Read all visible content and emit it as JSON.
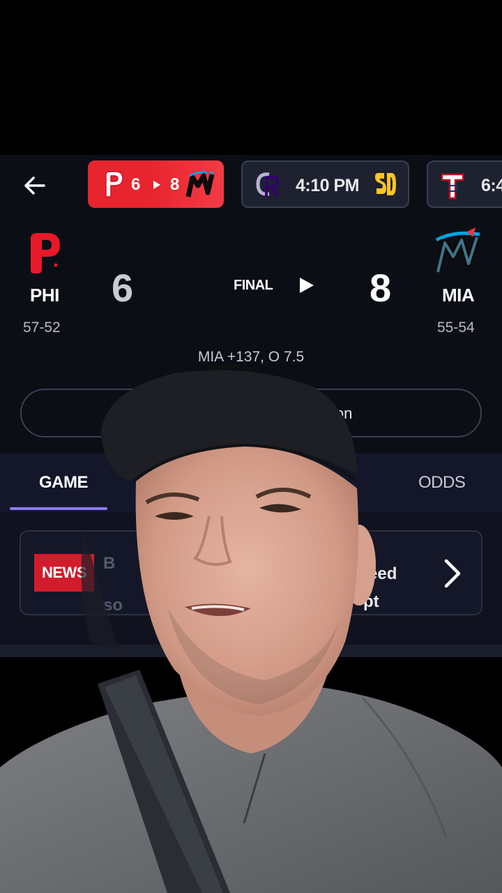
{
  "header": {
    "games": [
      {
        "away_score": "6",
        "home_score": "8",
        "status": "final"
      },
      {
        "time": "4:10 PM"
      },
      {
        "time": "6:4"
      }
    ]
  },
  "scoreboard": {
    "away": {
      "abbr": "PHI",
      "record": "57-52",
      "score": "6"
    },
    "home": {
      "abbr": "MIA",
      "record": "55-54",
      "score": "8"
    },
    "status": "FINAL",
    "odds": "MIA +137, O 7.5",
    "button_label": "ion"
  },
  "tabs": [
    {
      "label": "GAME",
      "active": true
    },
    {
      "label": "ODDS",
      "active": false
    }
  ],
  "news": {
    "badge": "NEWS",
    "line1_left": "B",
    "line1_right": "eed",
    "line2_left": "so",
    "line2_right": "pt"
  },
  "colors": {
    "accent": "#8c7cf2",
    "active_chip": "#e8242f",
    "news_badge": "#d21c2b",
    "background": "#0c0e16"
  },
  "icons": [
    "back-arrow-icon",
    "phillies-logo-icon",
    "marlins-logo-icon",
    "rockies-logo-icon",
    "padres-logo-icon",
    "rangers-logo-icon",
    "play-icon",
    "chevron-right-icon"
  ]
}
